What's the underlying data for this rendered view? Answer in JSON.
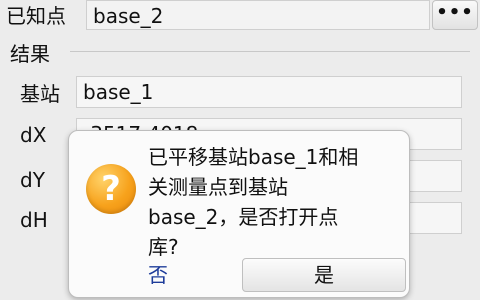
{
  "known_point": {
    "label": "已知点",
    "value": "base_2",
    "more_label": "•••"
  },
  "results": {
    "title": "结果",
    "station_label": "基站",
    "station_value": "base_1",
    "dx_label": "dX",
    "dx_value": "-3517.4018",
    "dy_label": "dY",
    "dy_value": "",
    "dh_label": "dH",
    "dh_value": ""
  },
  "dialog": {
    "icon": "question-icon",
    "message": "已平移基站base_1和相\n关测量点到基站\nbase_2，是否打开点\n库?",
    "no_label": "否",
    "yes_label": "是"
  }
}
